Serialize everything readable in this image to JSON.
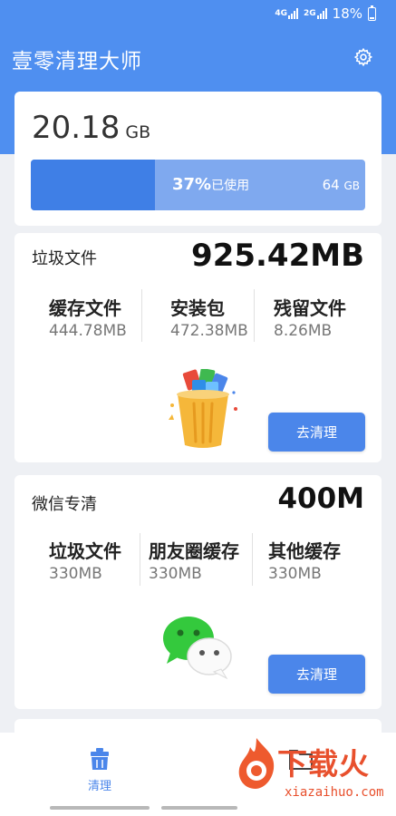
{
  "status_bar": {
    "net_top": "4G",
    "net_bottom": "2G",
    "battery": "18%"
  },
  "header": {
    "title": "壹零清理大师",
    "settings_icon": "gear-icon",
    "accent": "#4f8ff0"
  },
  "storage": {
    "amount": "20.18",
    "unit": "GB",
    "used_percent": "37%",
    "used_label": "已使用",
    "used_fraction": 0.37,
    "total_value": "64",
    "total_unit": "GB"
  },
  "junk": {
    "title": "垃圾文件",
    "total": "925.42MB",
    "categories": [
      {
        "name": "缓存文件",
        "value": "444.78MB"
      },
      {
        "name": "安装包",
        "value": "472.38MB"
      },
      {
        "name": "残留文件",
        "value": "8.26MB"
      }
    ],
    "illustration": "trash-bin-with-apps",
    "button_label": "去清理"
  },
  "wechat": {
    "title": "微信专清",
    "total": "400M",
    "categories": [
      {
        "name": "垃圾文件",
        "value": "330MB"
      },
      {
        "name": "朋友圈缓存",
        "value": "330MB"
      },
      {
        "name": "其他缓存",
        "value": "330MB"
      }
    ],
    "illustration": "wechat-logo",
    "button_label": "去清理"
  },
  "tabbar": {
    "tabs": [
      {
        "label": "清理",
        "icon": "broom-icon"
      },
      {
        "label": "",
        "icon": "folder-icon"
      }
    ]
  },
  "watermark": {
    "text": "下载火",
    "url": "xiazaihuo.com"
  }
}
